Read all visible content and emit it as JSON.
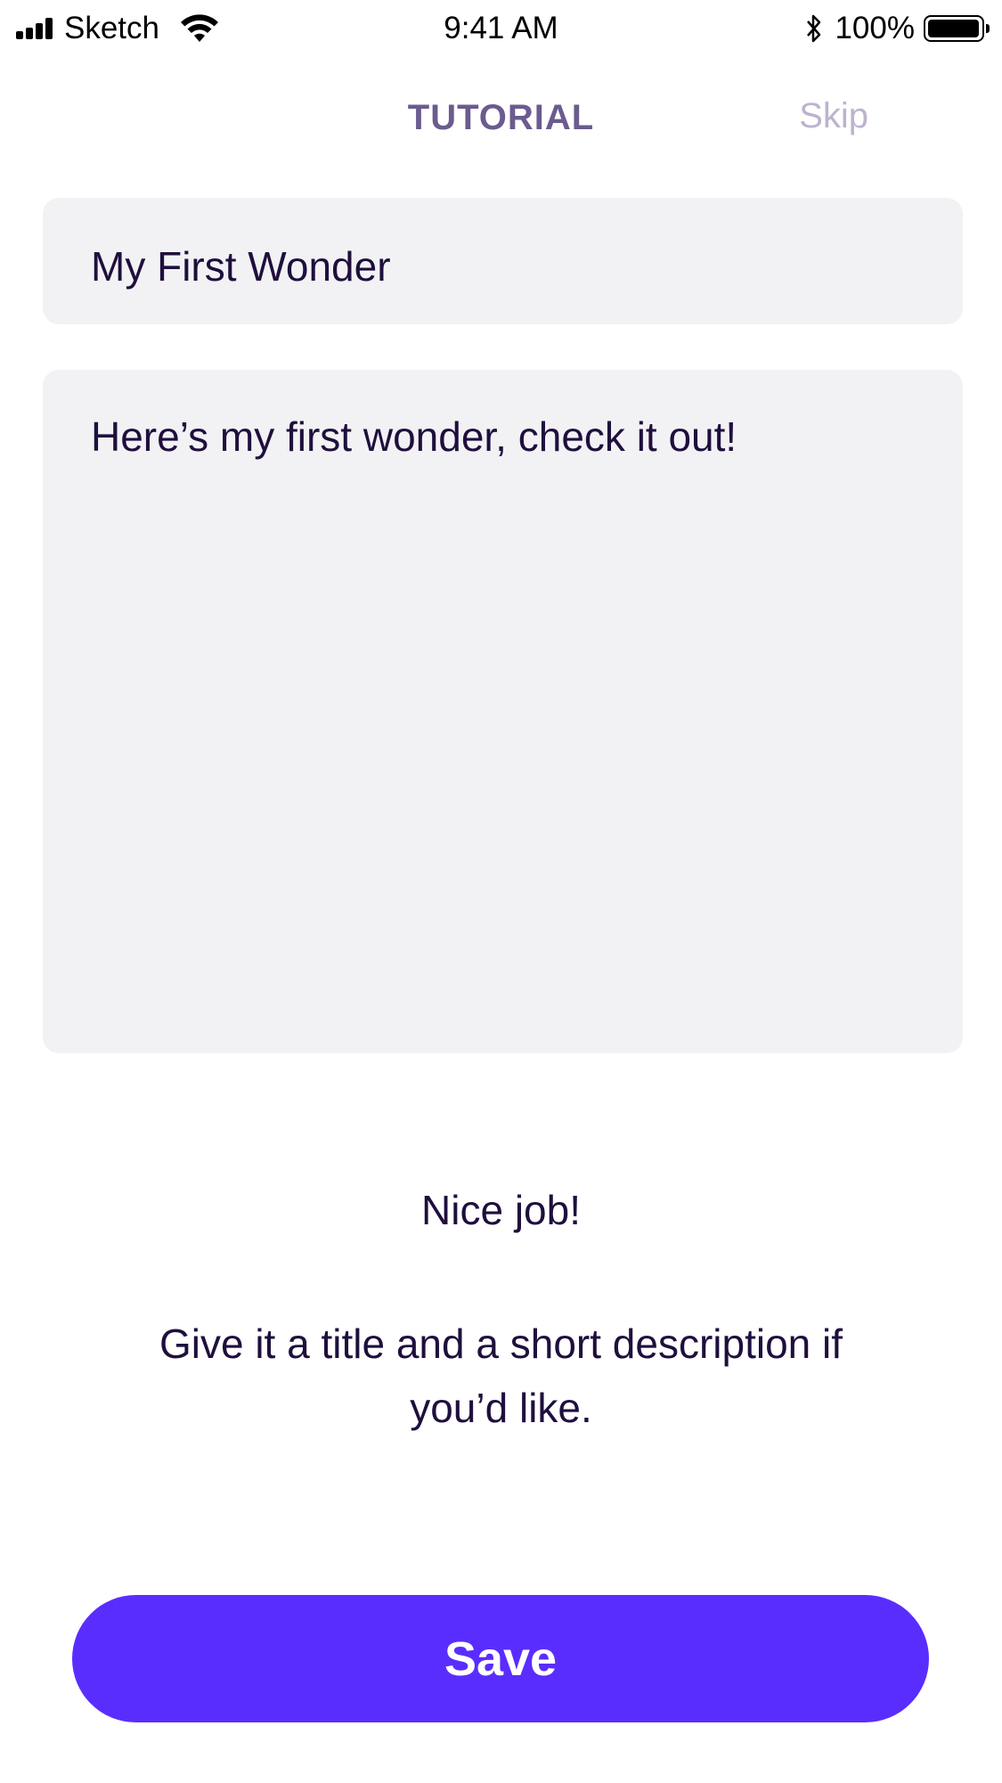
{
  "status_bar": {
    "carrier": "Sketch",
    "time": "9:41 AM",
    "battery_percent": "100%",
    "battery_level": 1.0
  },
  "nav": {
    "title": "TUTORIAL",
    "skip_label": "Skip"
  },
  "form": {
    "title_value": "My First Wonder",
    "description_value": "Here’s my first wonder, check it out!"
  },
  "message": {
    "headline": "Nice job!",
    "instruction": "Give it a title and a short description if you’d like."
  },
  "actions": {
    "save_label": "Save"
  },
  "colors": {
    "accent": "#5a2dff",
    "text": "#1f0f3d",
    "nav_title": "#6b5b8f",
    "skip": "#bdb3cf",
    "field_bg": "#f2f2f4"
  }
}
